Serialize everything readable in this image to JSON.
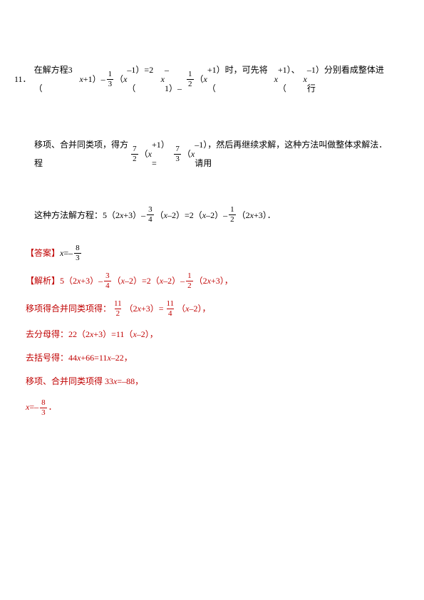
{
  "problem": {
    "number": "11．",
    "part1_a": "在解方程3（",
    "xp1_a": "x",
    "part1_b": "+1）– ",
    "frac1_n": "1",
    "frac1_d": "3",
    "part1_c": "（",
    "xm1_a": "x",
    "part1_d": "–1）=2（",
    "xm1_b": "x",
    "part1_e": "–1）– ",
    "frac2_n": "1",
    "frac2_d": "2",
    "part1_f": "（",
    "xp1_b": "x",
    "part1_g": "+1）时，可先将（",
    "xp1_c": "x",
    "part1_h": "+1）、（",
    "xm1_c": "x",
    "part1_i": "–1）分别看成整体进行",
    "part2_a": "移项、合并同类项，得方程",
    "frac3_n": "7",
    "frac3_d": "2",
    "part2_b": "（",
    "xp1_d": "x",
    "part2_c": "+1）= ",
    "frac4_n": "7",
    "frac4_d": "3",
    "part2_d": "（",
    "xm1_d": "x",
    "part2_e": "–1），然后再继续求解，这种方法叫做整体求解法．请用",
    "part3_a": "这种方法解方程：5（2",
    "x2_a": "x",
    "part3_b": "+3）– ",
    "frac5_n": "3",
    "frac5_d": "4",
    "part3_c": "（",
    "x2_b": "x",
    "part3_d": "–2）=2（",
    "x2_c": "x",
    "part3_e": "–2）– ",
    "frac6_n": "1",
    "frac6_d": "2",
    "part3_f": "（2",
    "x2_d": "x",
    "part3_g": "+3）．"
  },
  "answer": {
    "label": "【答案】",
    "xeq": "x",
    "eq": "=– ",
    "n": "8",
    "d": "3"
  },
  "analysis": {
    "label": "【解析】",
    "l1_a": "5（2",
    "l1_x1": "x",
    "l1_b": "+3）– ",
    "l1_f1n": "3",
    "l1_f1d": "4",
    "l1_c": "（",
    "l1_x2": "x",
    "l1_d": "–2）=2（",
    "l1_x3": "x",
    "l1_e": "–2）– ",
    "l1_f2n": "1",
    "l1_f2d": "2",
    "l1_f": "（2",
    "l1_x4": "x",
    "l1_g": "+3），",
    "l2_a": "移项得合并同类项得：",
    "l2_f1n": "11",
    "l2_f1d": "2",
    "l2_b": "（2",
    "l2_x1": "x",
    "l2_c": "+3）= ",
    "l2_f2n": "11",
    "l2_f2d": "4",
    "l2_d": "（",
    "l2_x2": "x",
    "l2_e": "–2），",
    "l3_a": "去分母得：22（2",
    "l3_x1": "x",
    "l3_b": "+3）=11（",
    "l3_x2": "x",
    "l3_c": "–2），",
    "l4_a": "去括号得：44",
    "l4_x1": "x",
    "l4_b": "+66=11",
    "l4_x2": "x",
    "l4_c": "–22，",
    "l5_a": "移项、合并同类项得 33",
    "l5_x": "x",
    "l5_b": "=–88，",
    "l6_a": "x",
    "l6_b": "=– ",
    "l6_n": "8",
    "l6_d": "3",
    "l6_c": "．"
  }
}
